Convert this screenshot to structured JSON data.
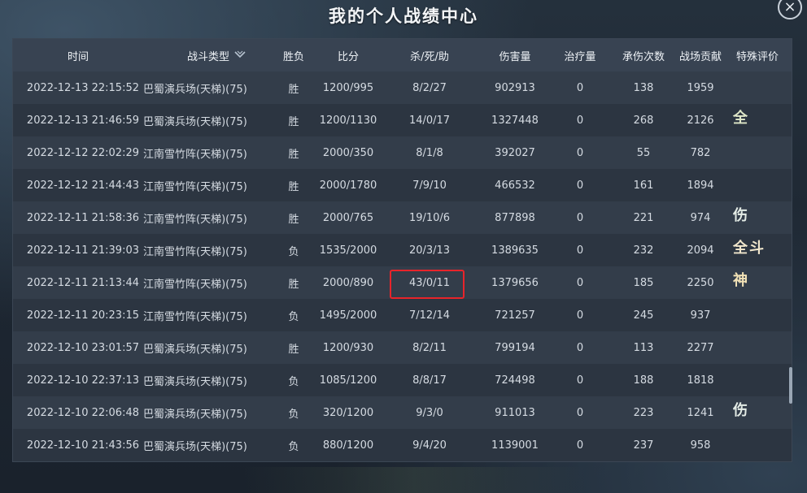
{
  "window": {
    "title": "我的个人战绩中心",
    "close_label": "×"
  },
  "header": {
    "time": "时间",
    "type": "战斗类型",
    "result": "胜负",
    "score": "比分",
    "kda": "杀/死/助",
    "damage": "伤害量",
    "heal": "治疗量",
    "hits": "承伤次数",
    "contribution": "战场贡献",
    "special": "特殊评价",
    "sort_icon": "chevron-sort-icon"
  },
  "rows": [
    {
      "time": "2022-12-13 22:15:52",
      "type": "巴蜀演兵场(天梯)(75)",
      "result": "胜",
      "score": "1200/995",
      "kda": "8/2/27",
      "damage": "902913",
      "heal": "0",
      "hits": "138",
      "contribution": "1959"
    },
    {
      "time": "2022-12-13 21:46:59",
      "type": "巴蜀演兵场(天梯)(75)",
      "result": "胜",
      "score": "1200/1130",
      "kda": "14/0/17",
      "damage": "1327448",
      "heal": "0",
      "hits": "268",
      "contribution": "2126"
    },
    {
      "time": "2022-12-12 22:02:29",
      "type": "江南雪竹阵(天梯)(75)",
      "result": "胜",
      "score": "2000/350",
      "kda": "8/1/8",
      "damage": "392027",
      "heal": "0",
      "hits": "55",
      "contribution": "782"
    },
    {
      "time": "2022-12-12 21:44:43",
      "type": "江南雪竹阵(天梯)(75)",
      "result": "胜",
      "score": "2000/1780",
      "kda": "7/9/10",
      "damage": "466532",
      "heal": "0",
      "hits": "161",
      "contribution": "1894"
    },
    {
      "time": "2022-12-11 21:58:36",
      "type": "江南雪竹阵(天梯)(75)",
      "result": "胜",
      "score": "2000/765",
      "kda": "19/10/6",
      "damage": "877898",
      "heal": "0",
      "hits": "221",
      "contribution": "974"
    },
    {
      "time": "2022-12-11 21:39:03",
      "type": "江南雪竹阵(天梯)(75)",
      "result": "负",
      "score": "1535/2000",
      "kda": "20/3/13",
      "damage": "1389635",
      "heal": "0",
      "hits": "232",
      "contribution": "2094"
    },
    {
      "time": "2022-12-11 21:13:44",
      "type": "江南雪竹阵(天梯)(75)",
      "result": "胜",
      "score": "2000/890",
      "kda": "43/0/11",
      "damage": "1379656",
      "heal": "0",
      "hits": "185",
      "contribution": "2250"
    },
    {
      "time": "2022-12-11 20:23:15",
      "type": "江南雪竹阵(天梯)(75)",
      "result": "负",
      "score": "1495/2000",
      "kda": "7/12/14",
      "damage": "721257",
      "heal": "0",
      "hits": "245",
      "contribution": "937"
    },
    {
      "time": "2022-12-10 23:01:57",
      "type": "巴蜀演兵场(天梯)(75)",
      "result": "胜",
      "score": "1200/930",
      "kda": "8/2/11",
      "damage": "799194",
      "heal": "0",
      "hits": "113",
      "contribution": "2277"
    },
    {
      "time": "2022-12-10 22:37:13",
      "type": "巴蜀演兵场(天梯)(75)",
      "result": "负",
      "score": "1085/1200",
      "kda": "8/8/17",
      "damage": "724498",
      "heal": "0",
      "hits": "188",
      "contribution": "1818"
    },
    {
      "time": "2022-12-10 22:06:48",
      "type": "巴蜀演兵场(天梯)(75)",
      "result": "负",
      "score": "320/1200",
      "kda": "9/3/0",
      "damage": "911013",
      "heal": "0",
      "hits": "223",
      "contribution": "1241"
    },
    {
      "time": "2022-12-10 21:43:56",
      "type": "巴蜀演兵场(天梯)(75)",
      "result": "负",
      "score": "880/1200",
      "kda": "9/4/20",
      "damage": "1139001",
      "heal": "0",
      "hits": "237",
      "contribution": "958"
    }
  ],
  "special_marks": [
    {
      "text": "全",
      "color": "#dfe7c8"
    },
    {
      "text": "伤",
      "color": "#e4ece6"
    },
    {
      "text": "全斗",
      "color": "#f0e6cc"
    },
    {
      "text": "神",
      "color": "#f2e2b6"
    },
    {
      "text": "伤",
      "color": "#e4ece6"
    }
  ],
  "highlight_color": "#e8242a"
}
